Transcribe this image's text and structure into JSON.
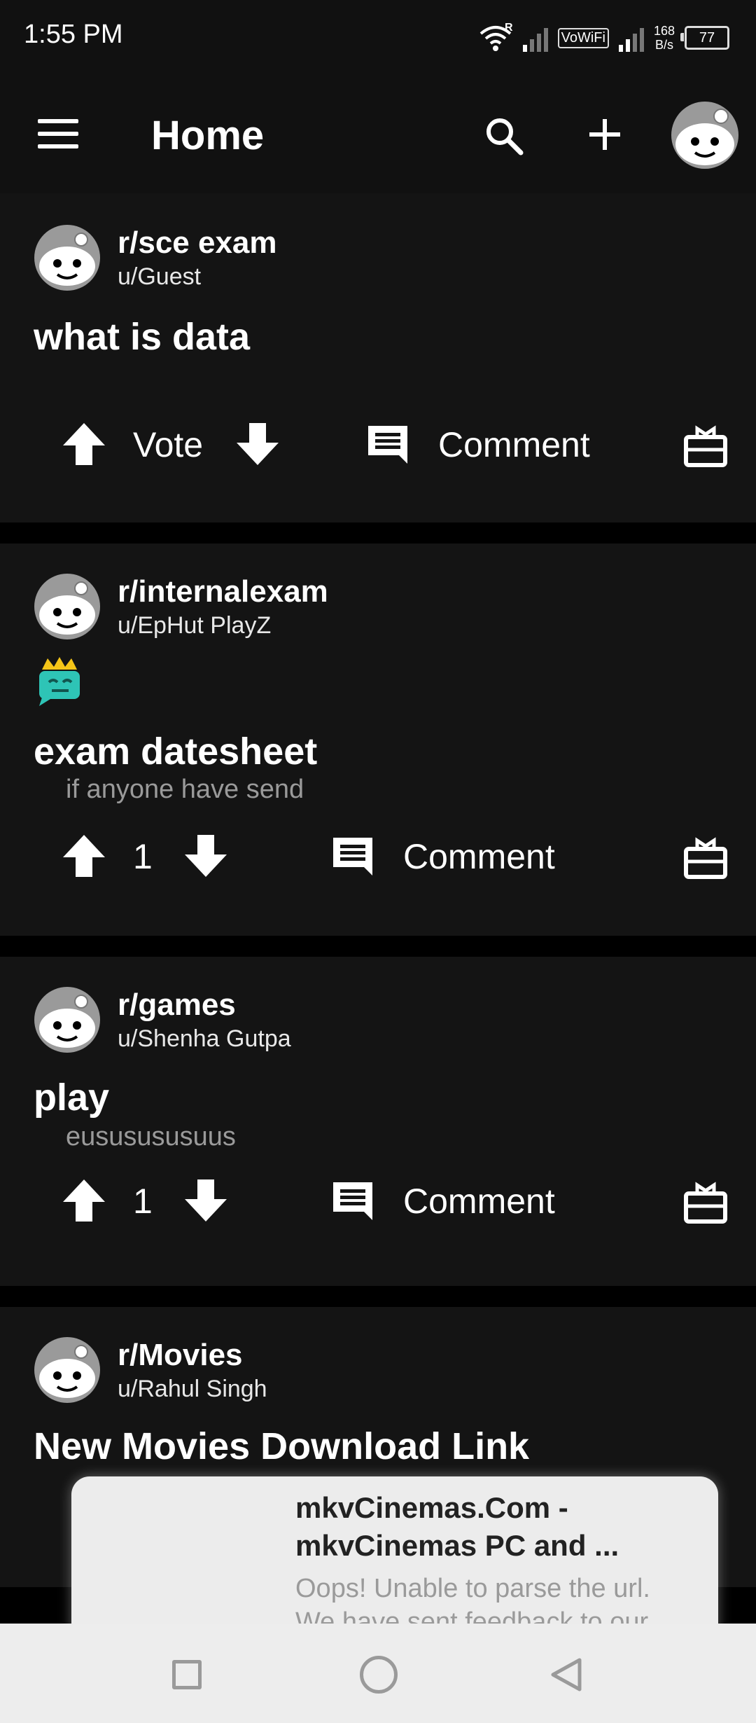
{
  "status_bar": {
    "time": "1:55 PM",
    "vowifi": "VoWiFi",
    "speed_value": "168",
    "speed_unit": "B/s",
    "battery": "77",
    "roaming": "R"
  },
  "app_bar": {
    "title": "Home",
    "icons": [
      "menu-icon",
      "search-icon",
      "plus-icon",
      "avatar"
    ]
  },
  "posts": [
    {
      "subreddit": "r/sce exam",
      "user": "u/Guest",
      "title": "what is data",
      "body": "",
      "vote_label": "Vote",
      "comment_label": "Comment"
    },
    {
      "subreddit": "r/internalexam",
      "user": "u/EpHut PlayZ",
      "title": "exam datesheet",
      "body": "if anyone have send",
      "vote_label": "1",
      "comment_label": "Comment"
    },
    {
      "subreddit": "r/games",
      "user": "u/Shenha Gutpa",
      "title": "play",
      "body": "eususususuus",
      "vote_label": "1",
      "comment_label": "Comment"
    },
    {
      "subreddit": "r/Movies",
      "user": "u/Rahul Singh",
      "title": "New Movies Download Link",
      "body": ""
    }
  ],
  "link_preview": {
    "title_line1": "mkvCinemas.Com -",
    "title_line2": "mkvCinemas PC and ...",
    "desc_line1": "Oops! Unable to parse the url.",
    "desc_line2": "We have sent feedback to our"
  },
  "colors": {
    "background": "#000000",
    "card": "#141414",
    "accent_teal": "#2ec4b6",
    "crown": "#f5c518"
  }
}
